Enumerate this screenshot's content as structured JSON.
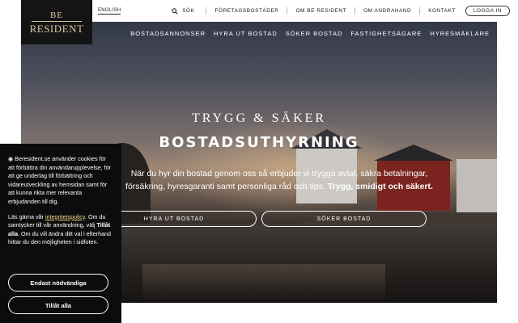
{
  "brand": {
    "logo_top": "BE",
    "logo_bottom": "RESIDENT",
    "colors": {
      "logo_bg": "#141414",
      "logo_text": "#d9c8a4",
      "link_accent": "#f0d98a"
    }
  },
  "topbar": {
    "language": "ENGLISH",
    "search_label": "SÖK",
    "links": [
      "FÖRETAGSBOSTÄDER",
      "OM BE RESIDENT",
      "OM ANDRAHAND",
      "KONTAKT"
    ],
    "login_label": "LOGGA IN"
  },
  "main_nav": {
    "items": [
      "BOSTADSANNONSER",
      "HYRA UT BOSTAD",
      "SÖKER BOSTAD",
      "FASTIGHETSÄGARE",
      "HYRESMÄKLARE"
    ]
  },
  "hero": {
    "tagline": "TRYGG & SÄKER",
    "headline": "BOSTADSUTHYRNING",
    "lead_text": "När du hyr din bostad genom oss så erbjuder vi trygga avtal, säkra betalningar, försäkring, hyresgaranti samt personliga råd och tips.",
    "lead_bold": "Trygg, smidigt och säkert.",
    "cta_rent": "HYRA UT BOSTAD",
    "cta_seek": "SÖKER BOSTAD"
  },
  "cookie": {
    "icon": "cookie-icon",
    "text_1": "Beresident.se använder cookies för att förbättra din användarupplevelse, för att ge underlag till förbättring och vidareutveckling av hemsidan samt för att kunna rikta mer relevanta erbjudanden till dig.",
    "text_2a": "Läs gärna vår",
    "policy_link": "integritetspolicy",
    "text_2b": ". Om du samtycker till vår användning, välj",
    "allow_all_inline": "Tillåt alla",
    "text_2c": ". Om du vill ändra ditt val i efterhand hittar du den möjligheten i sidfoten.",
    "btn_necessary": "Endast nödvändiga",
    "btn_allow_all": "Tillåt alla"
  }
}
